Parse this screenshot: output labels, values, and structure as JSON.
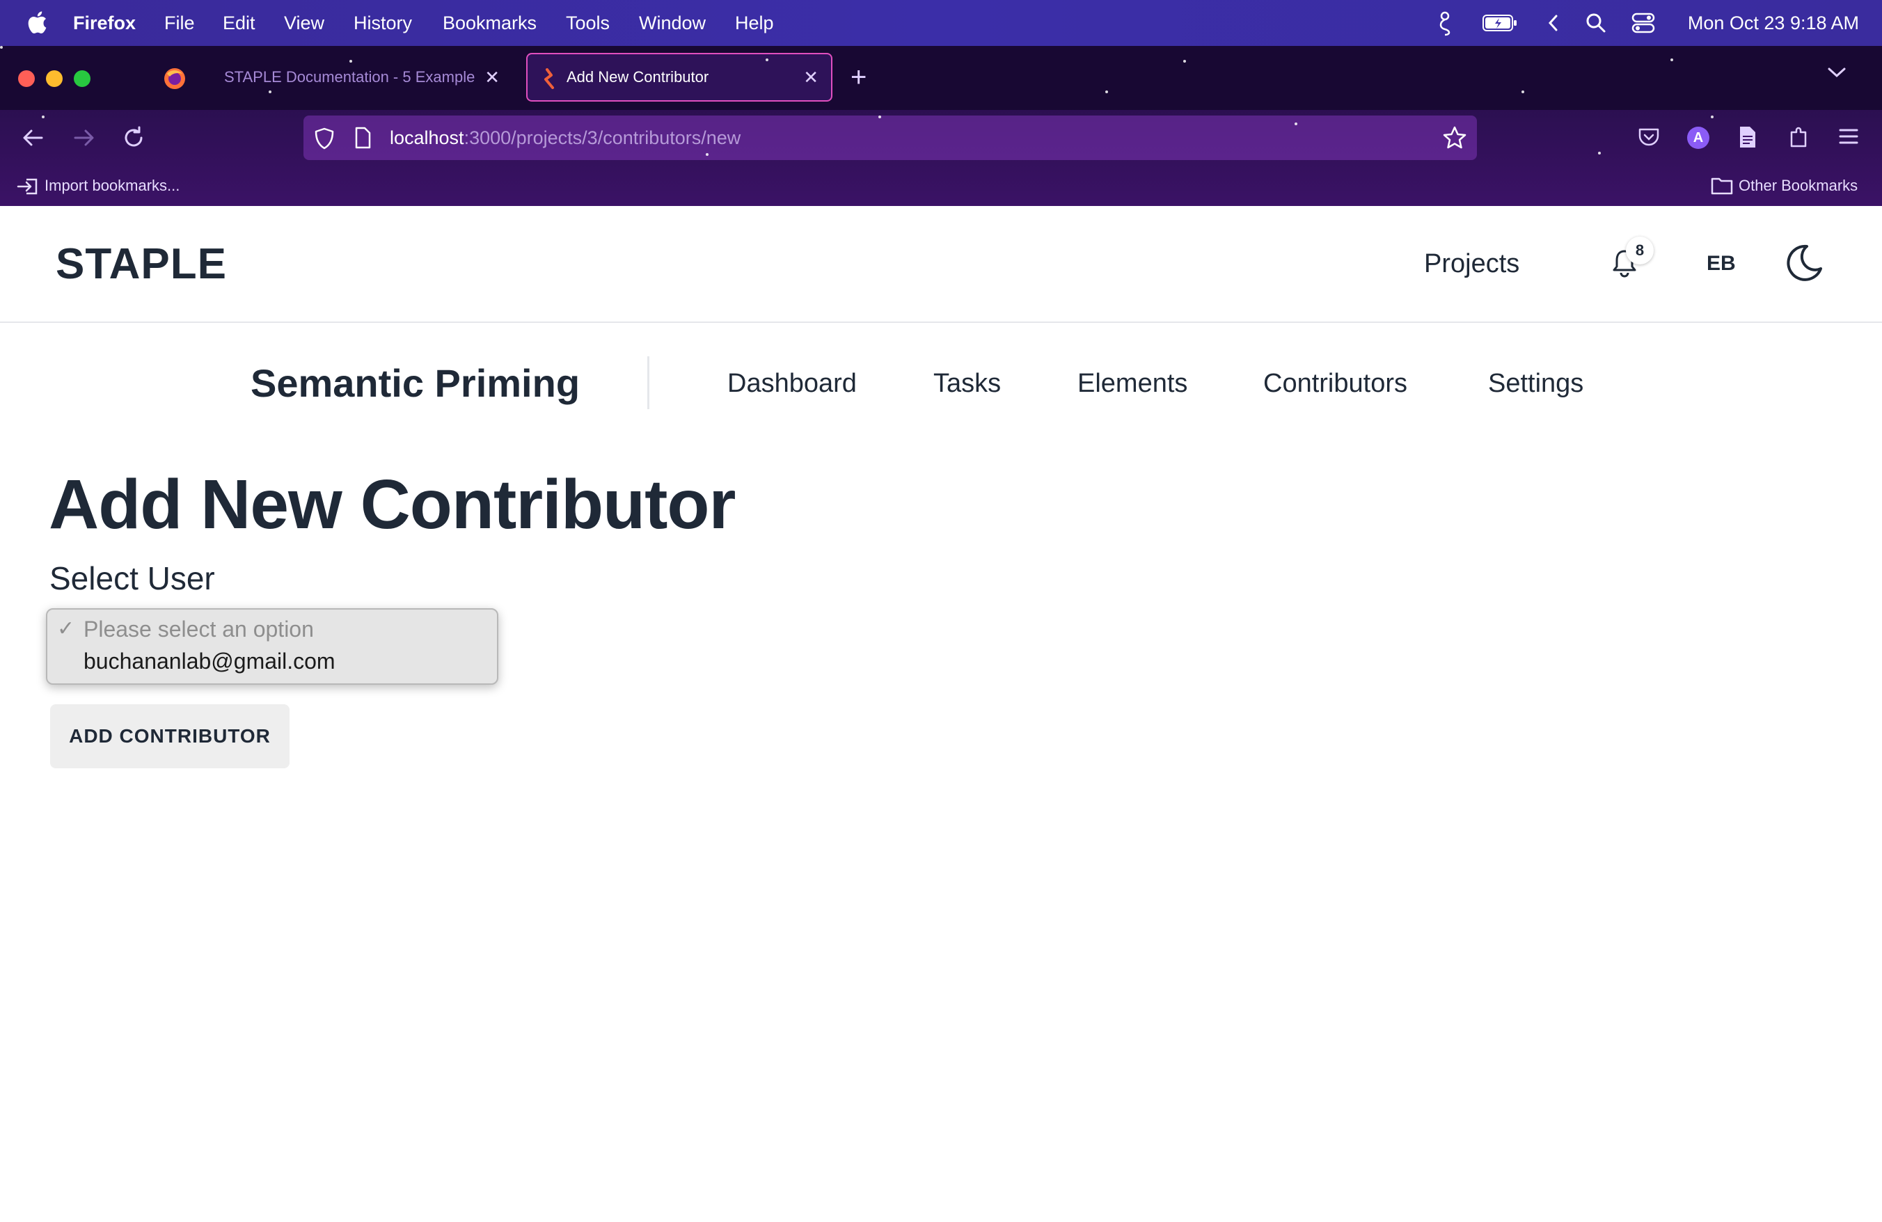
{
  "menubar": {
    "app_name": "Firefox",
    "items": [
      "File",
      "Edit",
      "View",
      "History",
      "Bookmarks",
      "Tools",
      "Window",
      "Help"
    ],
    "clock": "Mon Oct 23  9:18 AM"
  },
  "browser": {
    "tabs": [
      {
        "title": "STAPLE Documentation - 5  Example",
        "active": false
      },
      {
        "title": "Add New Contributor",
        "active": true
      }
    ],
    "url": {
      "host": "localhost",
      "path": ":3000/projects/3/contributors/new"
    },
    "bookmarks_bar": {
      "import_label": "Import bookmarks...",
      "other_label": "Other Bookmarks"
    },
    "account_initial": "A"
  },
  "header": {
    "logo": "STAPLE",
    "projects_link": "Projects",
    "notification_count": "8",
    "user_initials": "EB"
  },
  "project_nav": {
    "project_name": "Semantic Priming",
    "items": [
      "Dashboard",
      "Tasks",
      "Elements",
      "Contributors",
      "Settings"
    ]
  },
  "main": {
    "title": "Add New Contributor",
    "select_label": "Select User",
    "select_options": [
      "Please select an option",
      "buchananlab@gmail.com"
    ],
    "selected_marker": "✓",
    "submit_label": "ADD CONTRIBUTOR"
  },
  "colors": {
    "menubar": "#3b2ea8",
    "chrome_dark": "#180833",
    "chrome_accent": "#e04fbf",
    "text_primary": "#1f2937"
  }
}
